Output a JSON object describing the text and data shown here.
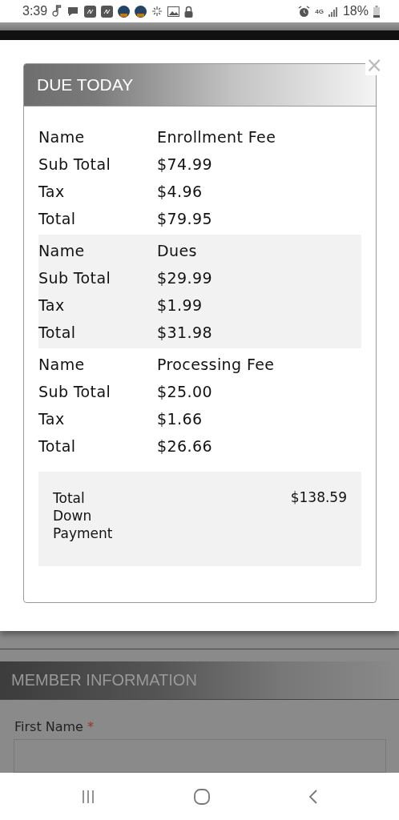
{
  "status_bar": {
    "time": "3:39",
    "network": "4G",
    "battery": "18%"
  },
  "modal": {
    "title": "DUE TODAY",
    "close": "×",
    "groups": [
      {
        "highlighted": false,
        "rows": [
          {
            "label": "Name",
            "value": "Enrollment Fee"
          },
          {
            "label": "Sub Total",
            "value": "$74.99"
          },
          {
            "label": "Tax",
            "value": "$4.96"
          },
          {
            "label": "Total",
            "value": "$79.95"
          }
        ]
      },
      {
        "highlighted": true,
        "rows": [
          {
            "label": "Name",
            "value": "Dues"
          },
          {
            "label": "Sub Total",
            "value": "$29.99"
          },
          {
            "label": "Tax",
            "value": "$1.99"
          },
          {
            "label": "Total",
            "value": "$31.98"
          }
        ]
      },
      {
        "highlighted": false,
        "rows": [
          {
            "label": "Name",
            "value": "Processing Fee"
          },
          {
            "label": "Sub Total",
            "value": "$25.00"
          },
          {
            "label": "Tax",
            "value": "$1.66"
          },
          {
            "label": "Total",
            "value": "$26.66"
          }
        ]
      }
    ],
    "total": {
      "label": "Total Down Payment",
      "value": "$138.59"
    }
  },
  "section": {
    "title": "MEMBER INFORMATION",
    "field": {
      "label": "First Name",
      "required": true,
      "required_mark": "*"
    }
  }
}
